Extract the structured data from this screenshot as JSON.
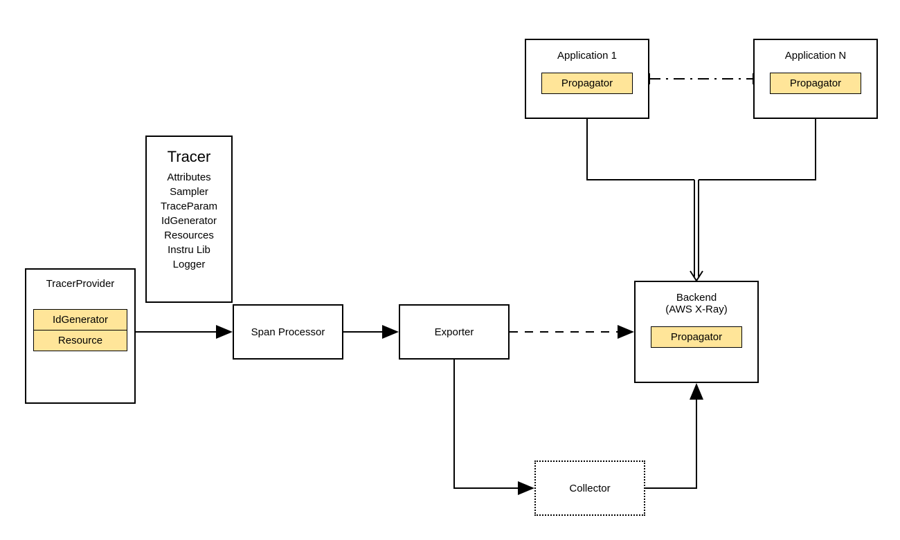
{
  "tracerProvider": {
    "title": "TracerProvider",
    "idGenerator": "IdGenerator",
    "resource": "Resource"
  },
  "tracer": {
    "title": "Tracer",
    "attrs": [
      "Attributes",
      "Sampler",
      "TraceParam",
      "IdGenerator",
      "Resources",
      "Instru Lib",
      "Logger"
    ]
  },
  "spanProcessor": {
    "title": "Span Processor"
  },
  "exporter": {
    "title": "Exporter"
  },
  "collector": {
    "title": "Collector"
  },
  "backend": {
    "title": "Backend",
    "subtitle": "(AWS X-Ray)",
    "propagator": "Propagator"
  },
  "app1": {
    "title": "Application 1",
    "propagator": "Propagator"
  },
  "appN": {
    "title": "Application N",
    "propagator": "Propagator"
  }
}
